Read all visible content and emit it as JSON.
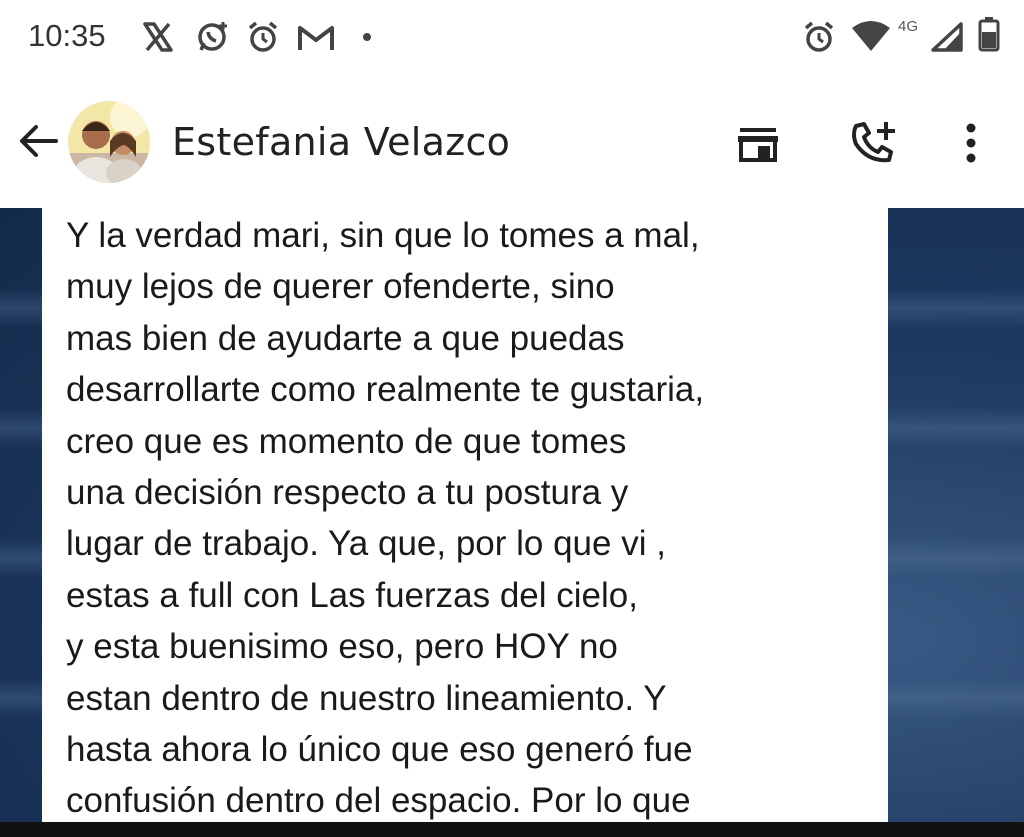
{
  "status_bar": {
    "time": "10:35",
    "left_icons": [
      "x-icon",
      "whatsapp-business-icon",
      "alarm-icon",
      "gmail-icon",
      "dot-icon"
    ],
    "right_icons": [
      "alarm-icon",
      "wifi-icon",
      "signal-icon",
      "battery-icon"
    ],
    "network_label": "4G"
  },
  "header": {
    "contact_name": "Estefania Velazco",
    "back_icon": "arrow-left-icon",
    "actions": [
      "storefront-icon",
      "add-call-icon",
      "more-vert-icon"
    ]
  },
  "message": {
    "text": "Y la verdad mari, sin que lo tomes a mal,\nmuy lejos de querer ofenderte, sino\nmas bien de ayudarte a que puedas\ndesarrollarte como realmente te gustaria,\ncreo que es momento de que tomes\nuna decisión respecto a tu postura y\nlugar de trabajo. Ya que, por lo que vi ,\nestas a full con Las fuerzas del cielo,\ny esta buenisimo eso, pero HOY no\nestan dentro de nuestro lineamiento.  Y\nhasta ahora lo único que eso generó fue\nconfusión dentro del espacio. Por lo que"
  },
  "colors": {
    "chat_background": "#1e3a62",
    "bubble": "#ffffff",
    "text": "#1a1a1a",
    "icon": "#333333"
  }
}
